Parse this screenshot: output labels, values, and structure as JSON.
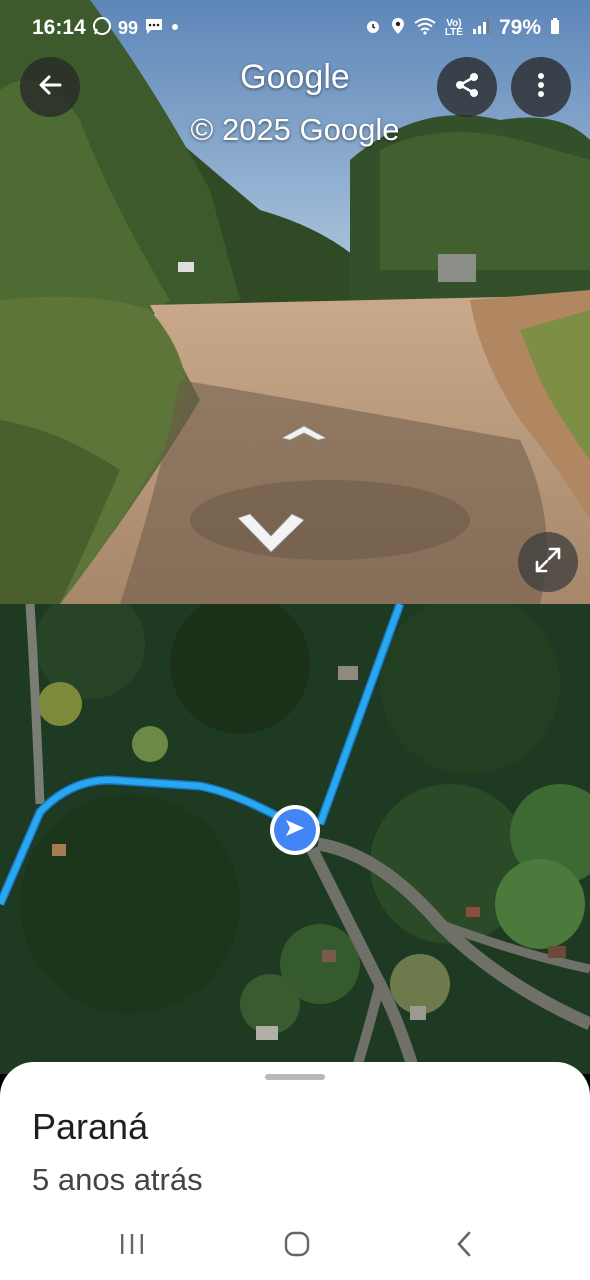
{
  "status_bar": {
    "time": "16:14",
    "notification_count": "99",
    "network": "LTE",
    "battery": "79%",
    "icons": [
      "whatsapp-icon",
      "chat-icon",
      "dot-icon",
      "alarm-icon",
      "location-icon",
      "wifi-icon",
      "volte-icon",
      "signal-icon",
      "battery-icon"
    ]
  },
  "street_view": {
    "title": "Google",
    "copyright": "© 2025 Google",
    "icons": [
      "back-arrow-icon",
      "share-icon",
      "more-vert-icon",
      "expand-icon",
      "chevron-up-icon",
      "chevron-down-icon"
    ]
  },
  "map": {
    "route_color": "#29a8f0",
    "marker_color": "#4285f4",
    "icons": [
      "navigation-arrow-icon"
    ]
  },
  "sheet": {
    "place": "Paraná",
    "age": "5 anos atrás"
  },
  "nav_bar": {
    "icons": [
      "recent-apps-icon",
      "home-icon",
      "back-chevron-icon"
    ]
  }
}
